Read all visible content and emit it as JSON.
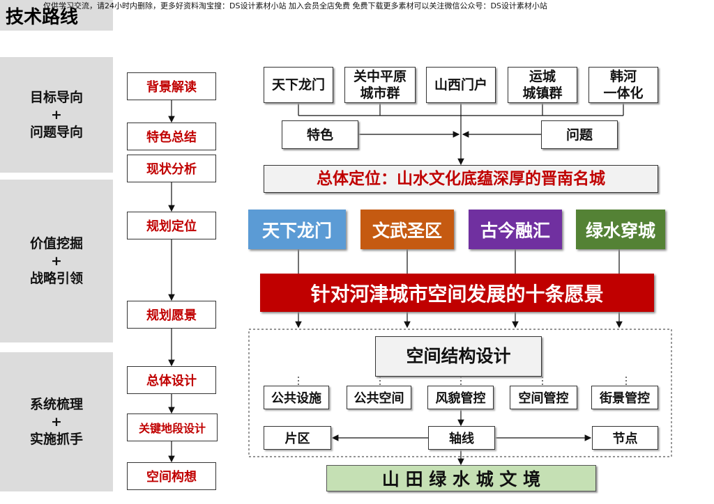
{
  "watermark": "仅供学习交流，请24小时内删除，更多好资料淘宝搜：DS设计素材小站  加入会员全店免费  免费下载更多素材可以关注微信公众号：DS设计素材小站",
  "title": "技术路线",
  "left_stages": [
    {
      "line1": "目标导向",
      "plus": "+",
      "line2": "问题导向"
    },
    {
      "line1": "价值挖掘",
      "plus": "+",
      "line2": "战略引领"
    },
    {
      "line1": "系统梳理",
      "plus": "+",
      "line2": "实施抓手"
    }
  ],
  "steps": [
    "背景解读",
    "特色总结",
    "现状分析",
    "规划定位",
    "规划愿景",
    "总体设计",
    "关键地段设计",
    "空间构想"
  ],
  "context_boxes": [
    {
      "line1": "天下龙门",
      "line2": ""
    },
    {
      "line1": "关中平原",
      "line2": "城市群"
    },
    {
      "line1": "山西门户",
      "line2": ""
    },
    {
      "line1": "运城",
      "line2": "城镇群"
    },
    {
      "line1": "韩河",
      "line2": "一体化"
    }
  ],
  "features_label": "特色",
  "issues_label": "问题",
  "positioning": "总体定位：山水文化底蕴深厚的晋南名城",
  "themes": [
    {
      "label": "天下龙门",
      "color": "#5b9bd5"
    },
    {
      "label": "文武圣区",
      "color": "#c55a11"
    },
    {
      "label": "古今融汇",
      "color": "#7030a0"
    },
    {
      "label": "绿水穿城",
      "color": "#548235"
    }
  ],
  "vision_banner": "针对河津城市空间发展的十条愿景",
  "vision_color": "#c00000",
  "spatial_design": "空间结构设计",
  "controls": [
    "公共设施",
    "公共空间",
    "风貌管控",
    "空间管控",
    "街景管控"
  ],
  "structure": {
    "district": "片区",
    "axis": "轴线",
    "node": "节点"
  },
  "final": "山 田 绿 水 城 文 境",
  "final_color": "#c5e0b4"
}
